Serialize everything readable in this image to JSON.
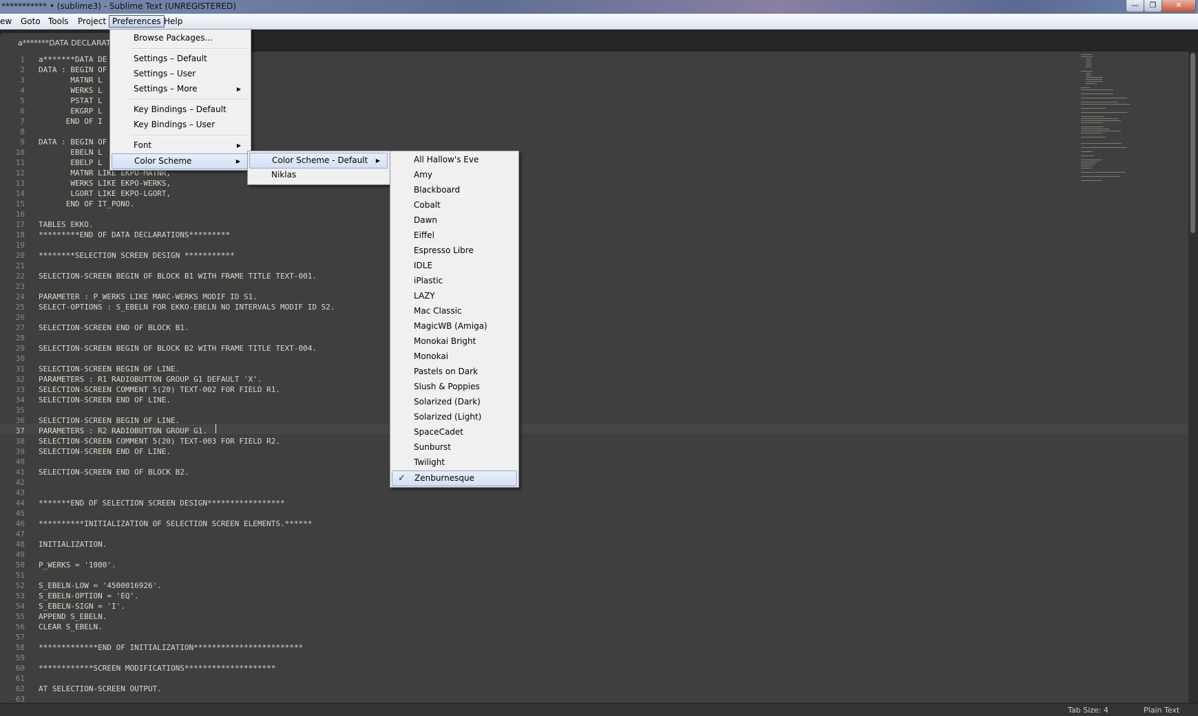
{
  "window": {
    "title": "*********** • (sublime3) - Sublime Text (UNREGISTERED)",
    "min_glyph": "—",
    "max_glyph": "❐",
    "close_glyph": "✕"
  },
  "menubar": {
    "items": [
      "ew",
      "Goto",
      "Tools",
      "Project",
      "Preferences",
      "Help"
    ],
    "active": "Preferences"
  },
  "tab": {
    "label": "a*******DATA DECLARATIO"
  },
  "preferences_menu": {
    "items": [
      {
        "label": "Browse Packages..."
      },
      {
        "label": "Settings – Default"
      },
      {
        "label": "Settings – User"
      },
      {
        "label": "Settings – More",
        "submenu": true
      },
      {
        "label": "Key Bindings – Default"
      },
      {
        "label": "Key Bindings – User"
      },
      {
        "label": "Font",
        "submenu": true
      },
      {
        "label": "Color Scheme",
        "submenu": true,
        "highlighted": true
      }
    ]
  },
  "color_scheme_menu": {
    "items": [
      {
        "label": "Color Scheme - Default",
        "submenu": true,
        "highlighted": true
      },
      {
        "label": "Niklas"
      }
    ]
  },
  "scheme_list": {
    "items": [
      "All Hallow's Eve",
      "Amy",
      "Blackboard",
      "Cobalt",
      "Dawn",
      "Eiffel",
      "Espresso Libre",
      "IDLE",
      "iPlastic",
      "LAZY",
      "Mac Classic",
      "MagicWB (Amiga)",
      "Monokai Bright",
      "Monokai",
      "Pastels on Dark",
      "Slush & Poppies",
      "Solarized (Dark)",
      "Solarized (Light)",
      "SpaceCadet",
      "Sunburst",
      "Twilight",
      "Zenburnesque"
    ],
    "checked": "Zenburnesque",
    "check_glyph": "✓"
  },
  "editor": {
    "current_line": 37,
    "lines": [
      "a*******DATA DE",
      "DATA : BEGIN OF",
      "       MATNR L",
      "       WERKS L",
      "       PSTAT L",
      "       EKGRP L",
      "      END OF I",
      "",
      "DATA : BEGIN OF",
      "       EBELN L",
      "       EBELP L",
      "       MATNR LIKE EKPO-MATNR,",
      "       WERKS LIKE EKPO-WERKS,",
      "       LGORT LIKE EKPO-LGORT,",
      "      END OF IT_PONO.",
      "",
      "TABLES EKKO.",
      "*********END OF DATA DECLARATIONS*********",
      "",
      "********SELECTION SCREEN DESIGN ***********",
      "",
      "SELECTION-SCREEN BEGIN OF BLOCK B1 WITH FRAME TITLE TEXT-001.",
      "",
      "PARAMETER : P_WERKS LIKE MARC-WERKS MODIF ID S1.",
      "SELECT-OPTIONS : S_EBELN FOR EKKO-EBELN NO INTERVALS MODIF ID S2.",
      "",
      "SELECTION-SCREEN END OF BLOCK B1.",
      "",
      "SELECTION-SCREEN BEGIN OF BLOCK B2 WITH FRAME TITLE TEXT-004.",
      "",
      "SELECTION-SCREEN BEGIN OF LINE.",
      "PARAMETERS : R1 RADIOBUTTON GROUP G1 DEFAULT 'X'.",
      "SELECTION-SCREEN COMMENT 5(20) TEXT-002 FOR FIELD R1.",
      "SELECTION-SCREEN END OF LINE.",
      "",
      "SELECTION-SCREEN BEGIN OF LINE.",
      "PARAMETERS : R2 RADIOBUTTON GROUP G1.",
      "SELECTION-SCREEN COMMENT 5(20) TEXT-003 FOR FIELD R2.",
      "SELECTION-SCREEN END OF LINE.",
      "",
      "SELECTION-SCREEN END OF BLOCK B2.",
      "",
      "",
      "*******END OF SELECTION SCREEN DESIGN*****************",
      "",
      "**********INITIALIZATION OF SELECTION SCREEN ELEMENTS.******",
      "",
      "INITIALIZATION.",
      "",
      "P_WERKS = '1000'.",
      "",
      "S_EBELN-LOW = '4500016926'.",
      "S_EBELN-OPTION = 'EQ'.",
      "S_EBELN-SIGN = 'I'.",
      "APPEND S_EBELN.",
      "CLEAR S_EBELN.",
      "",
      "*************END OF INITIALIZATION************************",
      "",
      "************SCREEN MODIFICATIONS********************",
      "",
      "AT SELECTION-SCREEN OUTPUT.",
      ""
    ]
  },
  "statusbar": {
    "tab_size": "Tab Size: 4",
    "syntax": "Plain Text"
  }
}
